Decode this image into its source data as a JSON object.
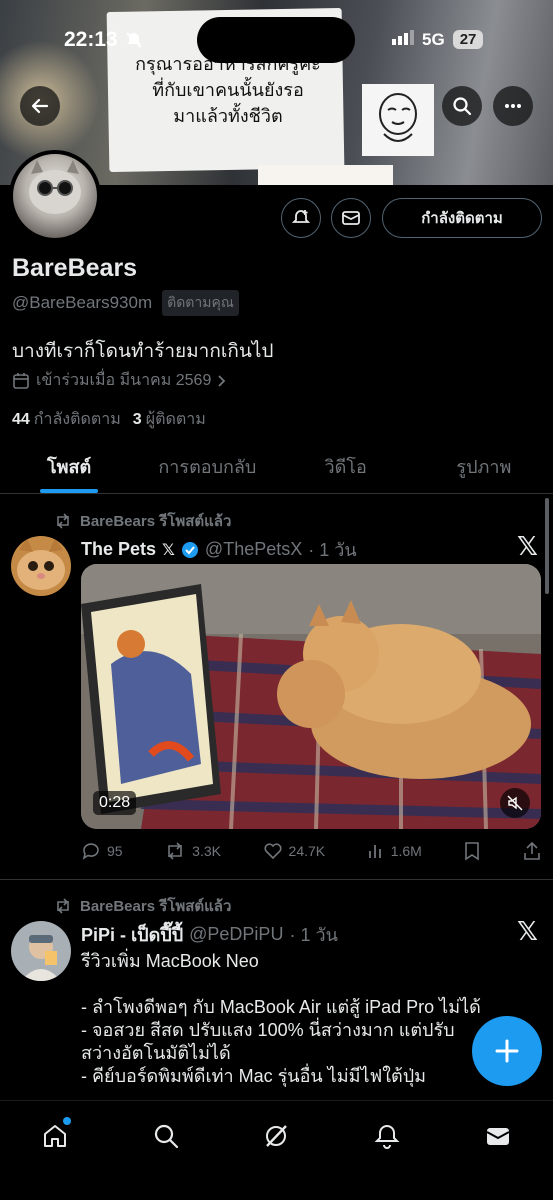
{
  "status_bar": {
    "time": "22:13",
    "network": "5G",
    "battery": "27"
  },
  "banner": {
    "sign_text": "กรุณารออาหารสักครู่คะ\nที่กับเขาคนนั้นยังรอ\nมาแล้วทั้งชีวิต"
  },
  "profile": {
    "name": "BareBears",
    "handle": "@BareBears930m",
    "follows_you": "ติดตามคุณ",
    "bio": "บางทีเราก็โดนทำร้ายมากเกินไป",
    "joined": "เข้าร่วมเมื่อ มีนาคม 2569",
    "following_count": "44",
    "following_label": "กำลังติดตาม",
    "followers_count": "3",
    "followers_label": "ผู้ติดตาม",
    "following_button": "กำลังติดตาม"
  },
  "tabs": [
    {
      "label": "โพสต์",
      "active": true
    },
    {
      "label": "การตอบกลับ",
      "active": false
    },
    {
      "label": "วิดีโอ",
      "active": false
    },
    {
      "label": "รูปภาพ",
      "active": false
    }
  ],
  "posts": [
    {
      "repost_label": "BareBears รีโพสต์แล้ว",
      "author_name": "The Pets",
      "author_handle": "@ThePetsX",
      "time": "· 1 วัน",
      "verified": true,
      "video_duration": "0:28",
      "stats": {
        "replies": "95",
        "reposts": "3.3K",
        "likes": "24.7K",
        "views": "1.6M"
      }
    },
    {
      "repost_label": "BareBears รีโพสต์แล้ว",
      "author_name": "PiPi - เป็ดปี๊ปี้",
      "author_handle": "@PeDPiPU",
      "time": "· 1 วัน",
      "text": "รีวิวเพิ่ม MacBook Neo\n\n- ลำโพงดีพอๆ กับ MacBook Air แต่สู้ iPad Pro ไม่ได้\n- จอสวย สีสด ปรับแสง 100% นี่สว่างมาก แต่ปรับ\nสว่างอัตโนมัติไม่ได้\n- คีย์บอร์ดพิมพ์ดีเท่า Mac รุ่นอื่น ไม่มีไฟใต้ปุ่ม"
    }
  ],
  "colors": {
    "accent": "#1d9bf0",
    "muted": "#71767b",
    "background": "#000000"
  }
}
